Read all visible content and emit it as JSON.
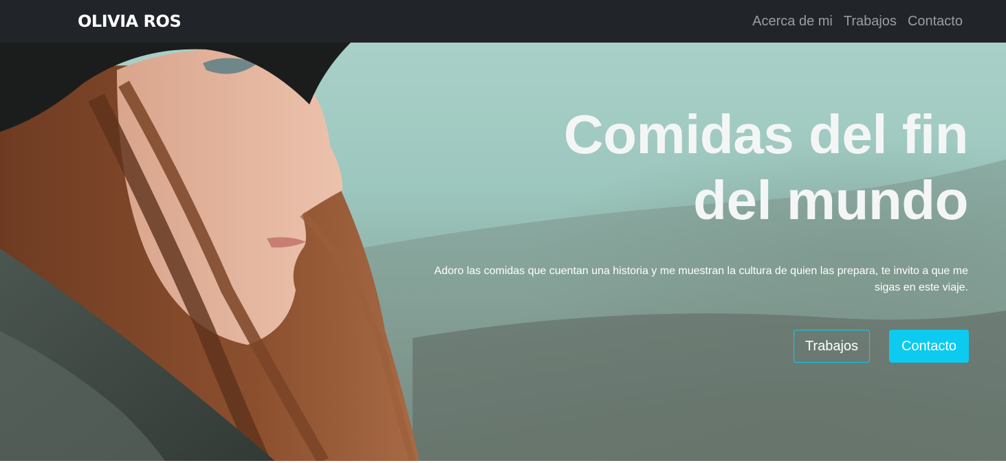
{
  "navbar": {
    "brand": "OLIVIA ROS",
    "links": [
      {
        "label": "Acerca de mi"
      },
      {
        "label": "Trabajos"
      },
      {
        "label": "Contacto"
      }
    ]
  },
  "hero": {
    "title_line1": "Comidas del fin",
    "title_line2": "del mundo",
    "description": "Adoro las comidas que cuentan una historia y me muestran la cultura de quien las prepara, te invito a que me sigas en este viaje.",
    "buttons": {
      "primary_outline": "Trabajos",
      "primary_solid": "Contacto"
    }
  },
  "colors": {
    "navbar_bg": "#212529",
    "accent": "#0dcaf0"
  }
}
